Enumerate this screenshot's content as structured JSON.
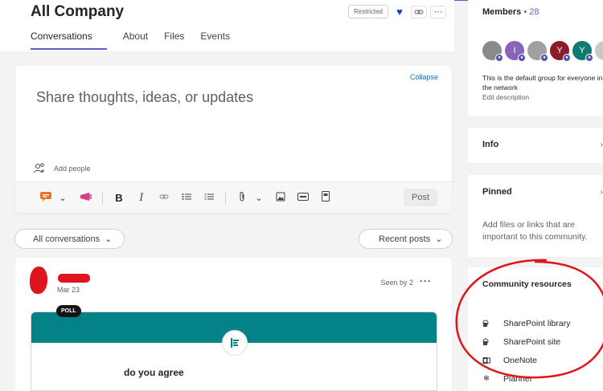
{
  "header": {
    "title": "All Company",
    "badge": "Restricted",
    "tabs": [
      {
        "label": "Conversations",
        "active": true
      },
      {
        "label": "About"
      },
      {
        "label": "Files"
      },
      {
        "label": "Events"
      }
    ]
  },
  "composer": {
    "collapse_label": "Collapse",
    "placeholder": "Share thoughts, ideas, or updates",
    "add_people_label": "Add people",
    "post_label": "Post"
  },
  "filters": {
    "left": "All conversations",
    "right": "Recent posts"
  },
  "post": {
    "date": "Mar 23",
    "seen": "Seen by 2",
    "badge": "POLL",
    "question": "do you agree"
  },
  "sidebar": {
    "members": {
      "title": "Members",
      "separator": "•",
      "count": "28",
      "avatars": [
        {
          "initial": "",
          "color": "#8a8a8a"
        },
        {
          "initial": "I",
          "color": "#8764b8"
        },
        {
          "initial": "",
          "color": "#a0a0a0"
        },
        {
          "initial": "Y",
          "color": "#8b1c2b"
        },
        {
          "initial": "Y",
          "color": "#0f7a72"
        },
        {
          "initial": "",
          "color": "#c8c8c8"
        }
      ],
      "description": "This is the default group for everyone in the network",
      "edit_label": "Edit description"
    },
    "info": {
      "title": "Info"
    },
    "pinned": {
      "title": "Pinned",
      "text": "Add files or links that are important to this community."
    },
    "resources": {
      "title": "Community resources",
      "items": [
        {
          "label": "SharePoint library"
        },
        {
          "label": "SharePoint site"
        },
        {
          "label": "OneNote"
        },
        {
          "label": "Planner"
        }
      ]
    }
  },
  "colors": {
    "accent": "#5b5fc7",
    "poll_band": "#038387",
    "annotation": "#e0141c"
  }
}
